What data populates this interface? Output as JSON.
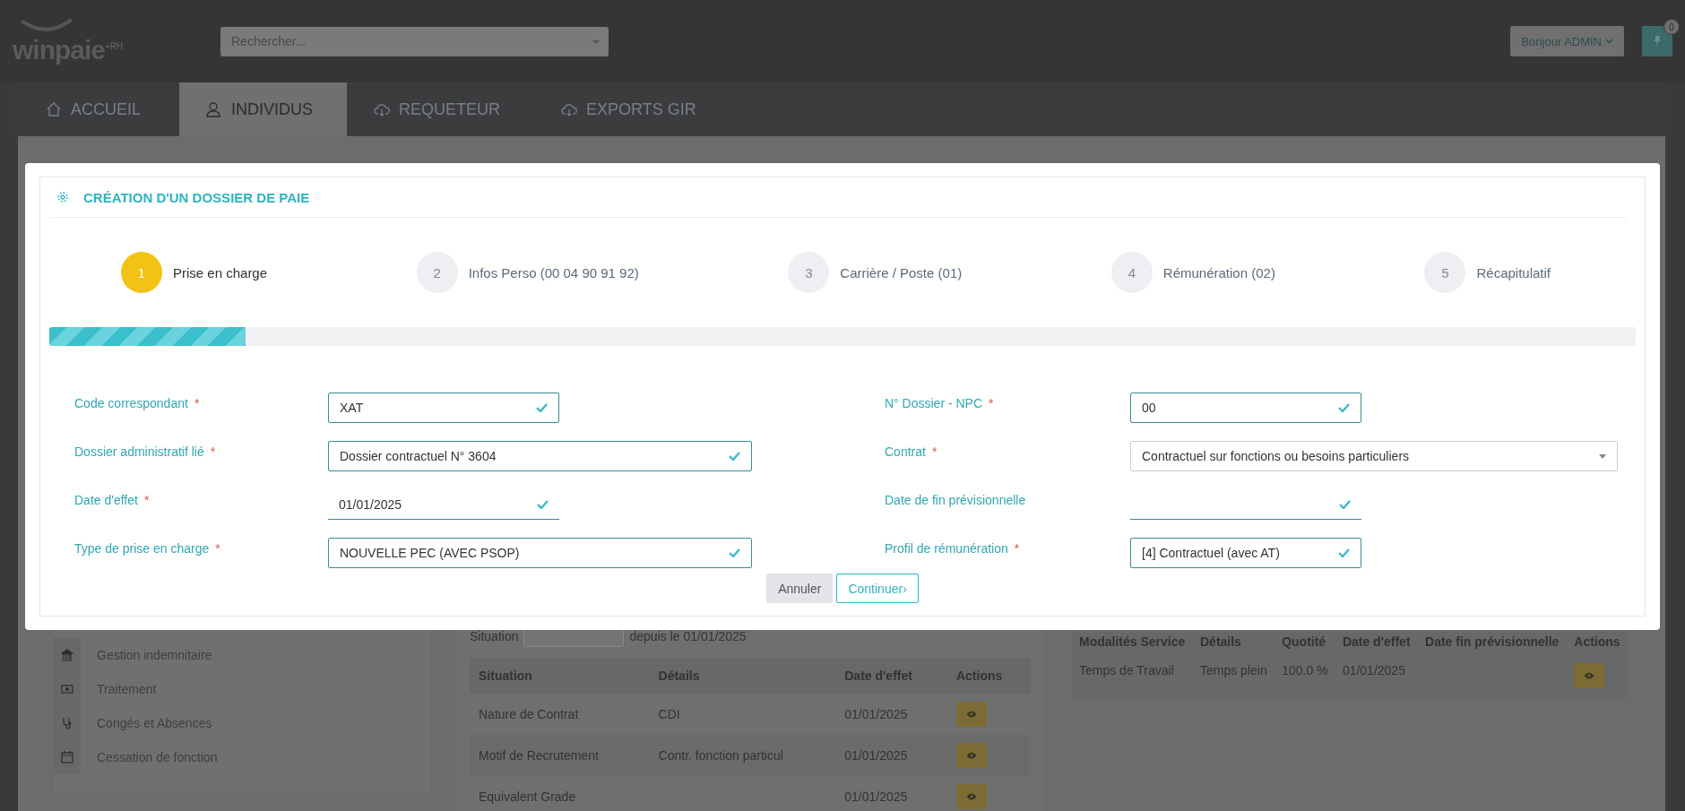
{
  "header": {
    "logo": "winpaie",
    "logo_suffix": "+RH",
    "search": {
      "placeholder": "Rechercher..."
    },
    "user_menu": "Bonjour ADMIN",
    "pin_badge": "0"
  },
  "nav_tabs": [
    {
      "label": "ACCUEIL",
      "selected": false
    },
    {
      "label": "INDIVIDUS",
      "selected": true
    },
    {
      "label": "REQUETEUR",
      "selected": false
    },
    {
      "label": "EXPORTS GIR",
      "selected": false
    }
  ],
  "sidebar": {
    "items": [
      {
        "label": "Gestion indemnitaire"
      },
      {
        "label": "Traitement"
      },
      {
        "label": "Congés et Absences"
      },
      {
        "label": "Cessation de fonction"
      }
    ]
  },
  "situation": {
    "label": "Situation",
    "since": "depuis le 01/01/2025"
  },
  "situation_table": {
    "columns": [
      "Situation",
      "Détails",
      "Date d'effet",
      "Actions"
    ],
    "rows": [
      [
        "Nature de Contrat",
        "CDI",
        "01/01/2025"
      ],
      [
        "Motif de Recrutement",
        "Contr. fonction particul",
        "01/01/2025"
      ],
      [
        "Equivalent Grade",
        "",
        "01/01/2025"
      ]
    ]
  },
  "service_table": {
    "columns": [
      "Modalités Service",
      "Détails",
      "Quotité",
      "Date d'effet",
      "Date fin prévisionnelle",
      "Actions"
    ],
    "rows": [
      [
        "Temps de Travail",
        "Temps plein",
        "100.0 %",
        "01/01/2025",
        ""
      ]
    ]
  },
  "modal": {
    "title": "CRÉATION D'UN DOSSIER DE PAIE",
    "steps": [
      {
        "number": "1",
        "label": "Prise en charge",
        "selected": true
      },
      {
        "number": "2",
        "label": "Infos Perso (00 04 90 91 92)",
        "selected": false
      },
      {
        "number": "3",
        "label": "Carrière / Poste (01)",
        "selected": false
      },
      {
        "number": "4",
        "label": "Rémunération (02)",
        "selected": false
      },
      {
        "number": "5",
        "label": "Récapitulatif",
        "selected": false
      }
    ],
    "progress": {
      "level": 0.124
    },
    "fields": [
      {
        "label": "Code correspondant",
        "required": true,
        "kind": "box",
        "value": "XAT",
        "valid": true
      },
      {
        "label": "N° Dossier - NPC",
        "required": true,
        "kind": "box",
        "value": "00",
        "valid": true
      },
      {
        "label": "Dossier administratif lié",
        "required": true,
        "kind": "box",
        "value": "Dossier contractuel N° 3604",
        "valid": true
      },
      {
        "label": "Contrat",
        "required": true,
        "kind": "select",
        "value": "Contractuel sur fonctions ou besoins particuliers"
      },
      {
        "label": "Date d'effet",
        "required": true,
        "kind": "line",
        "value": "01/01/2025",
        "valid": true
      },
      {
        "label": "Date de fin prévisionnelle",
        "required": false,
        "kind": "line",
        "valid": true
      },
      {
        "label": "Type de prise en charge",
        "required": true,
        "kind": "box",
        "value": "NOUVELLE PEC (AVEC PSOP)",
        "valid": true
      },
      {
        "label": "Profil de rémunération",
        "required": true,
        "kind": "box",
        "value": "[4] Contractuel (avec AT)",
        "valid": true
      }
    ],
    "required_mark": "*",
    "buttons": [
      {
        "label": "Annuler",
        "kind": "secondary"
      },
      {
        "label": "Continuer",
        "kind": "primary"
      }
    ],
    "continue_arrow": "›"
  }
}
